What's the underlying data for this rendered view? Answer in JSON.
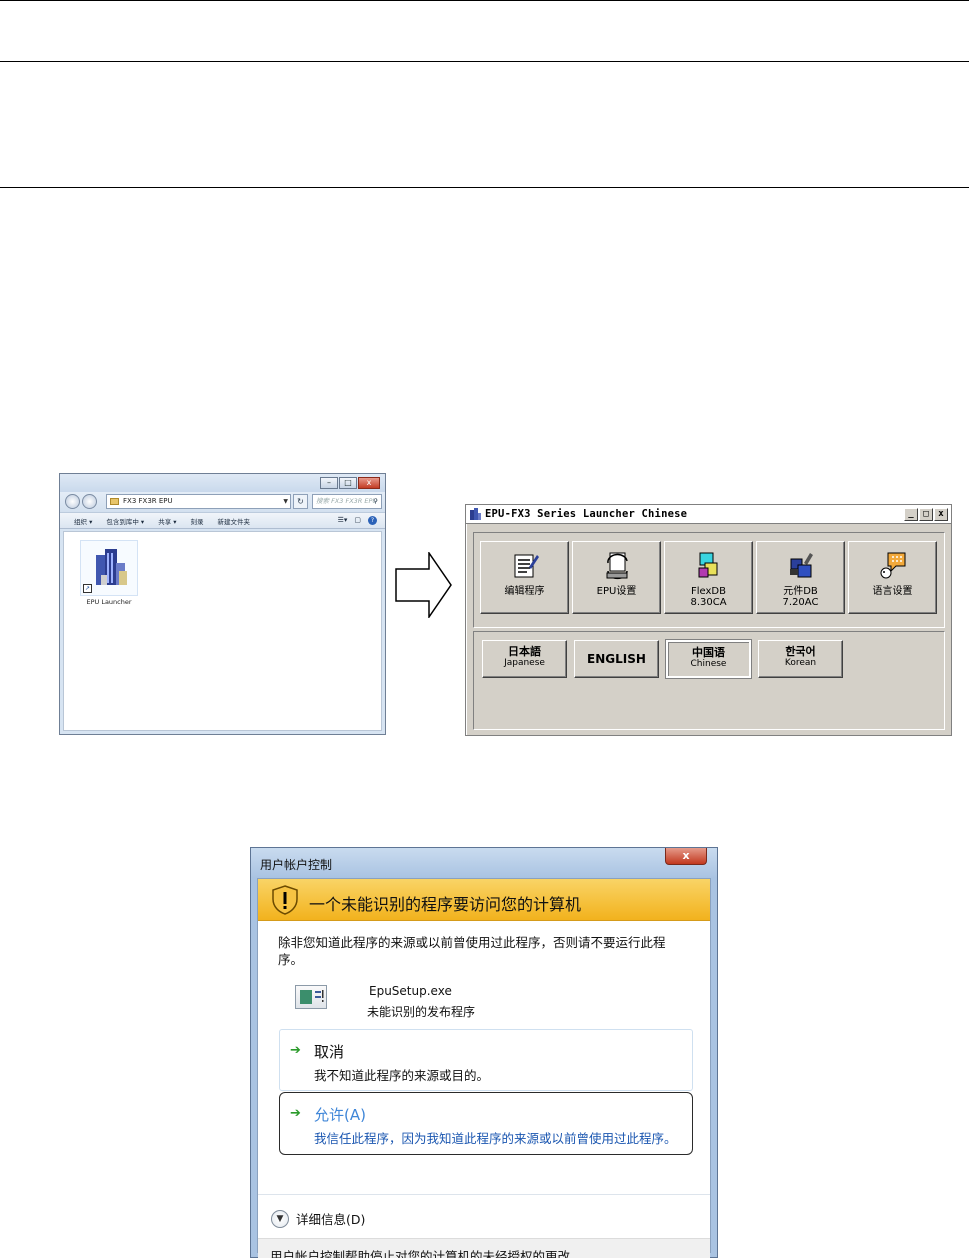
{
  "explorer": {
    "address": "FX3 FX3R EPU",
    "search_placeholder": "搜索 FX3 FX3R EPU",
    "toolbar": [
      "组织 ▾",
      "包含到库中 ▾",
      "共享 ▾",
      "刻录",
      "新建文件夹"
    ],
    "window_buttons": [
      "–",
      "□",
      "x"
    ],
    "file": {
      "label": "EPU Launcher"
    }
  },
  "launcher": {
    "title": "EPU-FX3 Series Launcher  Chinese",
    "window_buttons": [
      "_",
      "□",
      "x"
    ],
    "main_buttons": [
      {
        "label": "编辑程序",
        "icon": "edit-program-icon"
      },
      {
        "label": "EPU设置",
        "icon": "epu-settings-icon"
      },
      {
        "label": "FlexDB\n8.30CA",
        "icon": "flexdb-icon"
      },
      {
        "label": "元件DB\n7.20AC",
        "icon": "component-db-icon"
      },
      {
        "label": "语言设置",
        "icon": "language-settings-icon"
      }
    ],
    "languages": [
      {
        "native": "日本語",
        "sub": "Japanese"
      },
      {
        "native": "ENGLISH",
        "sub": ""
      },
      {
        "native": "中国语",
        "sub": "Chinese",
        "active": true
      },
      {
        "native": "한국어",
        "sub": "Korean"
      }
    ]
  },
  "uac": {
    "title": "用户帐户控制",
    "close_label": "x",
    "heading": "一个未能识别的程序要访问您的计算机",
    "message": "除非您知道此程序的来源或以前曾使用过此程序，否则请不要运行此程序。",
    "program_name": "EpuSetup.exe",
    "publisher": "未能识别的发布程序",
    "cancel_title": "取消",
    "cancel_desc": "我不知道此程序的来源或目的。",
    "allow_title": "允许(A)",
    "allow_desc": "我信任此程序，因为我知道此程序的来源或以前曾使用过此程序。",
    "details": "详细信息(D)",
    "footer": "用户帐户控制帮助停止对您的计算机的未经授权的更改。"
  }
}
